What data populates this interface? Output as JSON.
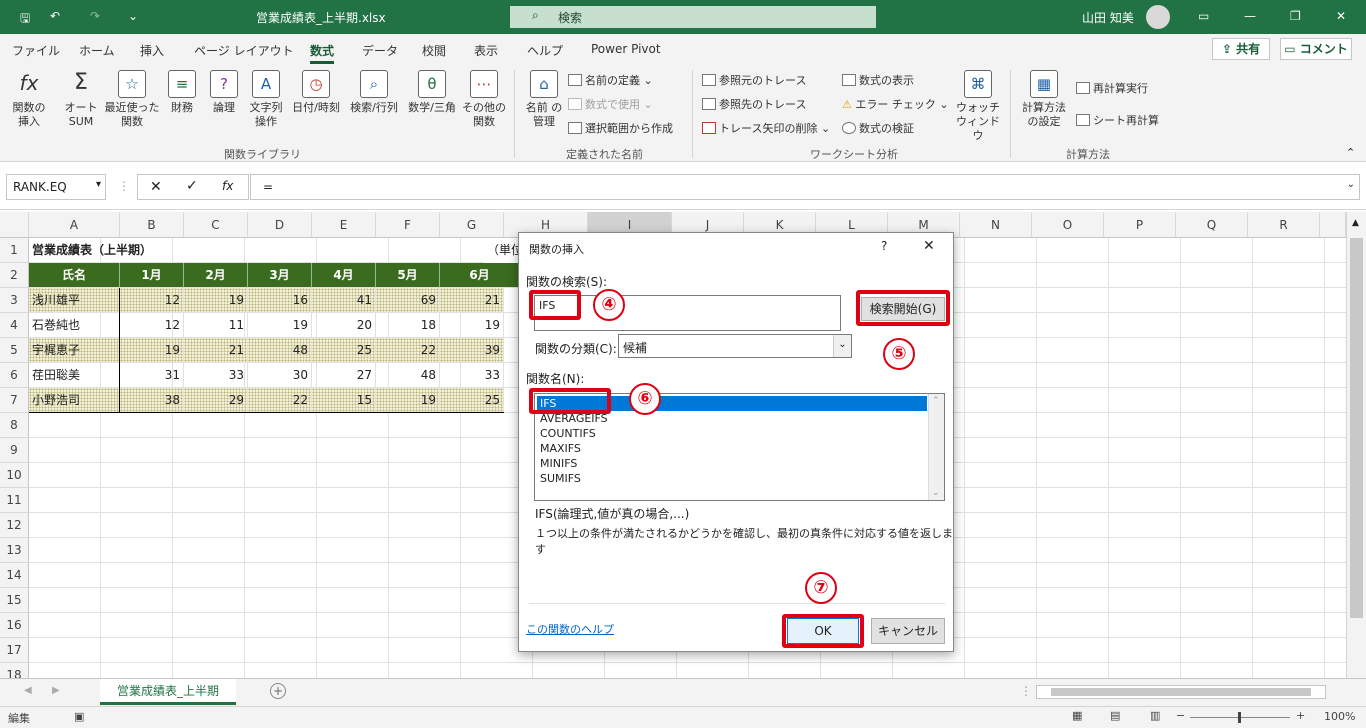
{
  "titlebar": {
    "filename": "営業成績表_上半期.xlsx",
    "search": "検索",
    "user": "山田 知美"
  },
  "tabs": [
    "ファイル",
    "ホーム",
    "挿入",
    "ページ レイアウト",
    "数式",
    "データ",
    "校閲",
    "表示",
    "ヘルプ",
    "Power Pivot"
  ],
  "share": "共有",
  "comment": "コメント",
  "ribbon": {
    "insert_function": "関数の挿入",
    "autosum": "オート SUM",
    "recent": "最近使った 関数",
    "financial": "財務",
    "logical": "論理",
    "text": "文字列 操作",
    "datetime": "日付/時刻",
    "lookup": "検索/行列",
    "math": "数学/三角",
    "other": "その他の 関数",
    "group_library": "関数ライブラリ",
    "name_manager": "名前 の管理",
    "define_name": "名前の定義",
    "use_in_formula": "数式で使用",
    "create_from_selection": "選択範囲から作成",
    "group_names": "定義された名前",
    "trace_precedents": "参照元のトレース",
    "trace_dependents": "参照先のトレース",
    "remove_arrows": "トレース矢印の削除",
    "show_formulas": "数式の表示",
    "error_check": "エラー チェック",
    "evaluate": "数式の検証",
    "watch": "ウォッチ ウィンドウ",
    "group_audit": "ワークシート分析",
    "calc_options": "計算方法 の設定",
    "calc_now": "再計算実行",
    "calc_sheet": "シート再計算",
    "group_calc": "計算方法"
  },
  "formula_bar": {
    "name": "RANK.EQ",
    "formula": "=",
    "fx": "fx"
  },
  "columns": [
    "A",
    "B",
    "C",
    "D",
    "E",
    "F",
    "G",
    "H",
    "I",
    "J",
    "K",
    "L",
    "M",
    "N",
    "O",
    "P",
    "Q",
    "R"
  ],
  "rows": [
    "1",
    "2",
    "3",
    "4",
    "5",
    "6",
    "7",
    "8",
    "9",
    "10",
    "11",
    "12",
    "13",
    "14",
    "15",
    "16",
    "17",
    "18"
  ],
  "sheet": {
    "title": "営業成績表（上半期）",
    "unit": "（単位",
    "headers": [
      "氏名",
      "1月",
      "2月",
      "3月",
      "4月",
      "5月",
      "6月"
    ],
    "data": [
      [
        "浅川雄平",
        "12",
        "19",
        "16",
        "41",
        "69",
        "21"
      ],
      [
        "石巻純也",
        "12",
        "11",
        "19",
        "20",
        "18",
        "19"
      ],
      [
        "宇梶恵子",
        "19",
        "21",
        "48",
        "25",
        "22",
        "39"
      ],
      [
        "荏田聡美",
        "31",
        "33",
        "30",
        "27",
        "48",
        "33"
      ],
      [
        "小野浩司",
        "38",
        "29",
        "22",
        "15",
        "19",
        "25"
      ]
    ]
  },
  "sheet_tab": "営業成績表_上半期",
  "status": {
    "mode": "編集",
    "zoom": "100%"
  },
  "dialog": {
    "title": "関数の挿入",
    "help_q": "?",
    "close": "✕",
    "search_label": "関数の検索(S):",
    "search_value": "IFS",
    "go_button": "検索開始(G)",
    "category_label": "関数の分類(C):",
    "category_value": "候補",
    "function_label": "関数名(N):",
    "functions": [
      "IFS",
      "AVERAGEIFS",
      "COUNTIFS",
      "MAXIFS",
      "MINIFS",
      "SUMIFS"
    ],
    "syntax": "IFS(論理式,値が真の場合,...)",
    "description": "１つ以上の条件が満たされるかどうかを確認し、最初の真条件に対応する値を返します",
    "help_link": "この関数のヘルプ",
    "ok": "OK",
    "cancel": "キャンセル"
  },
  "annotations": [
    "④",
    "⑤",
    "⑥",
    "⑦"
  ],
  "colors": {
    "excel_green": "#217346",
    "header_green": "#3a6b1f",
    "annotation_red": "#e00012",
    "selection_blue": "#0078d7"
  }
}
